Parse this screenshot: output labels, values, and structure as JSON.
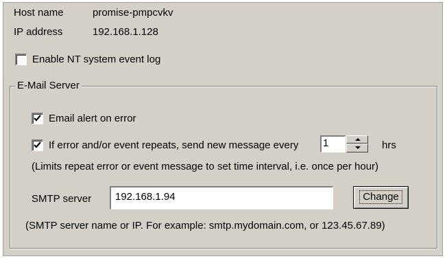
{
  "host": {
    "label": "Host name",
    "value": "promise-pmpcvkv"
  },
  "ip": {
    "label": "IP address",
    "value": "192.168.1.128"
  },
  "nt_event_log": {
    "label": "Enable NT system event log",
    "checked": false
  },
  "email_server": {
    "group_label": "E-Mail Server",
    "alert_on_error": {
      "label": "Email alert on error",
      "checked": true
    },
    "repeat": {
      "label": "If error and/or event repeats, send new message every",
      "checked": true,
      "interval_value": "1",
      "unit": "hrs",
      "hint": "(Limits repeat error or event message to set time interval, i.e. once per hour)"
    },
    "smtp": {
      "label": "SMTP server",
      "value": "192.168.1.94",
      "change_button": "Change",
      "hint": "(SMTP server name or IP. For example: smtp.mydomain.com, or 123.45.67.89)"
    }
  }
}
